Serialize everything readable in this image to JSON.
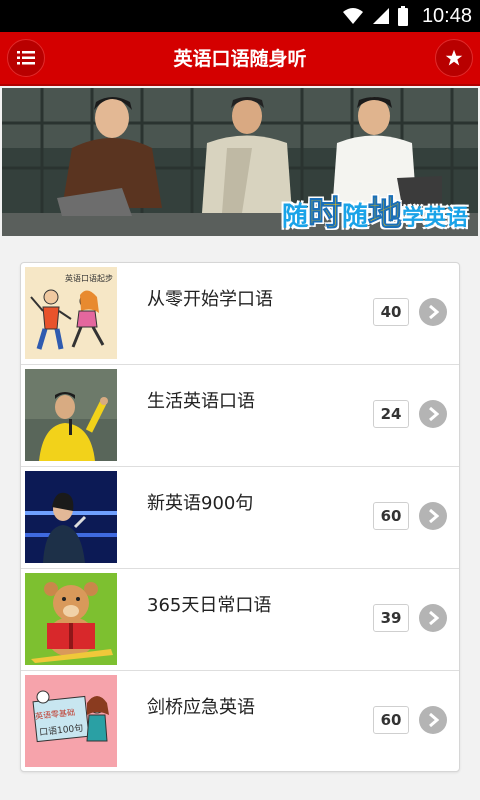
{
  "status": {
    "time": "10:48"
  },
  "header": {
    "title": "英语口语随身听"
  },
  "banner": {
    "caption": {
      "c1": "随",
      "c2": "时",
      "c3": "随",
      "c4": "地",
      "c5": "学英语"
    }
  },
  "thumb_texts": {
    "t1": "英语口语起步",
    "t5a": "英语零基础",
    "t5b": "口语100句"
  },
  "courses": [
    {
      "title": "从零开始学口语",
      "count": "40"
    },
    {
      "title": "生活英语口语",
      "count": "24"
    },
    {
      "title": "新英语900句",
      "count": "60"
    },
    {
      "title": "365天日常口语",
      "count": "39"
    },
    {
      "title": "剑桥应急英语",
      "count": "60"
    }
  ],
  "colors": {
    "appbar": "#d40000",
    "accent": "#ffd400"
  }
}
